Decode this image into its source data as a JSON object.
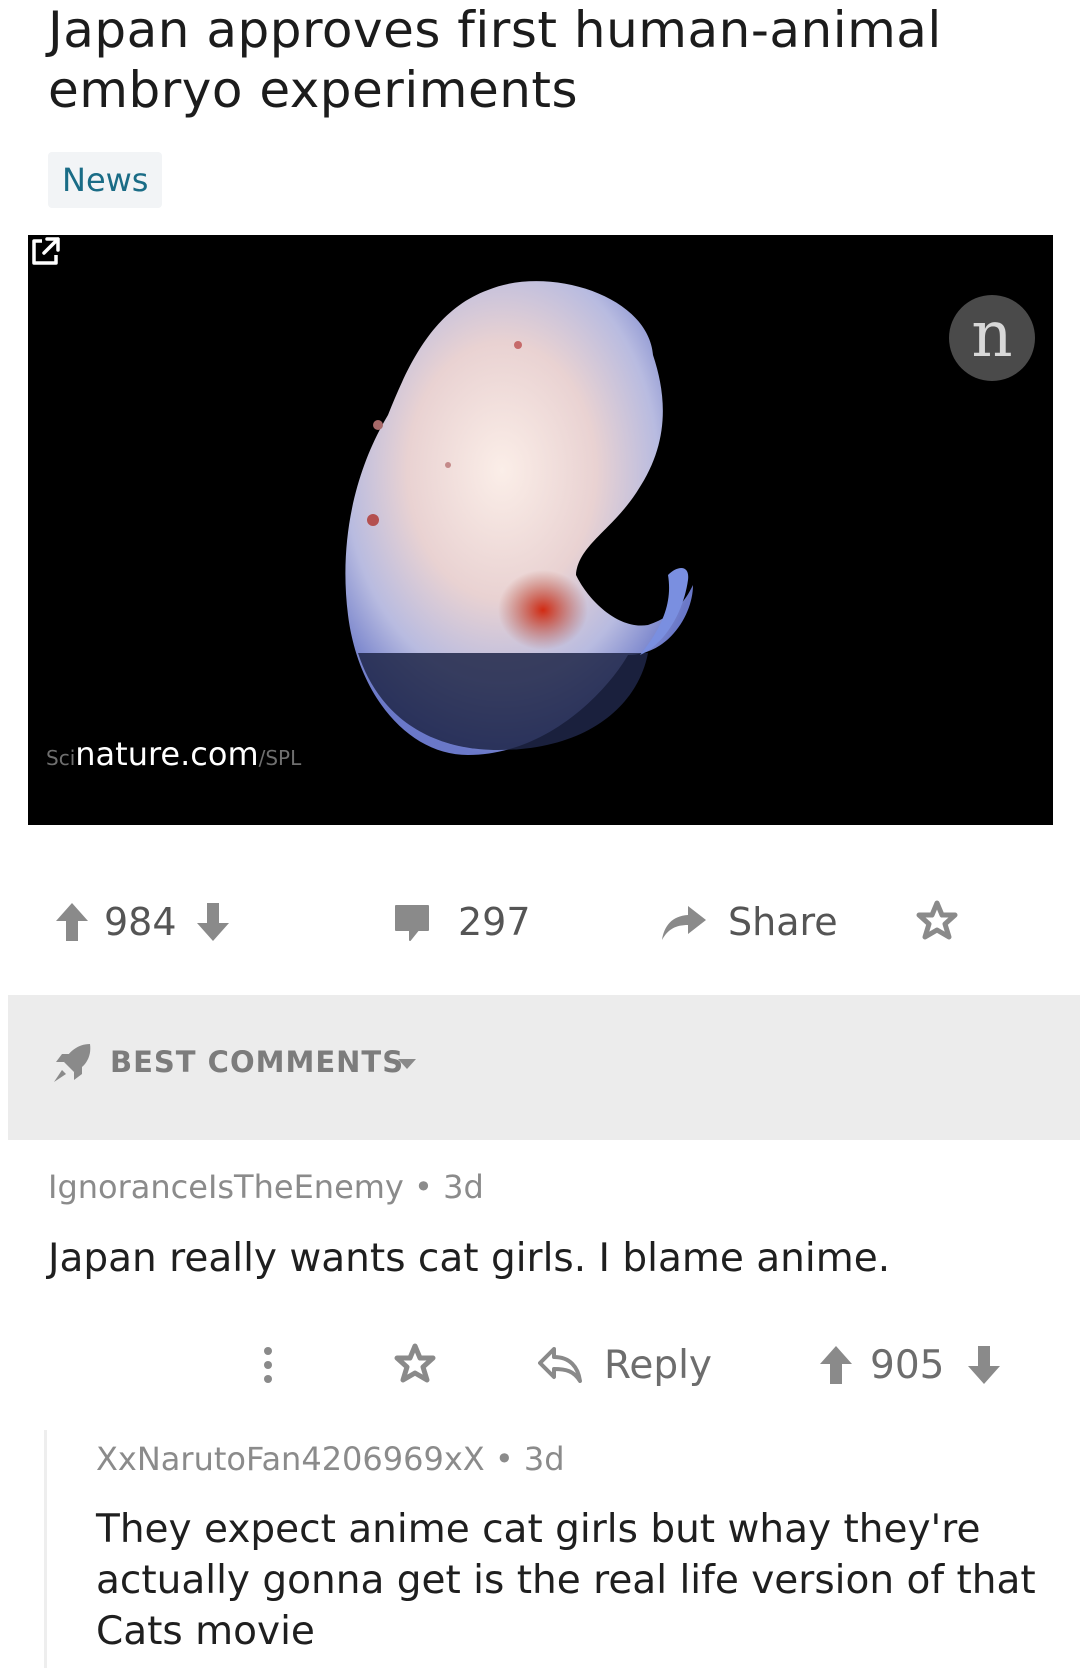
{
  "post": {
    "title": "Japan approves first human-animal embryo experiments",
    "flair": "News",
    "link": {
      "domain": "nature.com",
      "credit_prefix": "Sci",
      "credit_suffix": "/SPL",
      "badge_letter": "n"
    },
    "stats": {
      "score": "984",
      "comments": "297",
      "share_label": "Share"
    }
  },
  "sort": {
    "label": "BEST COMMENTS"
  },
  "comments": [
    {
      "author": "IgnoranceIsTheEnemy",
      "age": "3d",
      "body": "Japan really wants cat girls. I blame anime.",
      "reply_label": "Reply",
      "score": "905"
    },
    {
      "author": "XxNarutoFan4206969xX",
      "age": "3d",
      "body": "They expect anime cat girls but whay they're actually gonna get is the real life version of that Cats movie"
    }
  ],
  "colors": {
    "flair_text": "#1a6c86",
    "sort_bar_bg": "#ececec",
    "icon_gray": "#8a8a8a"
  }
}
